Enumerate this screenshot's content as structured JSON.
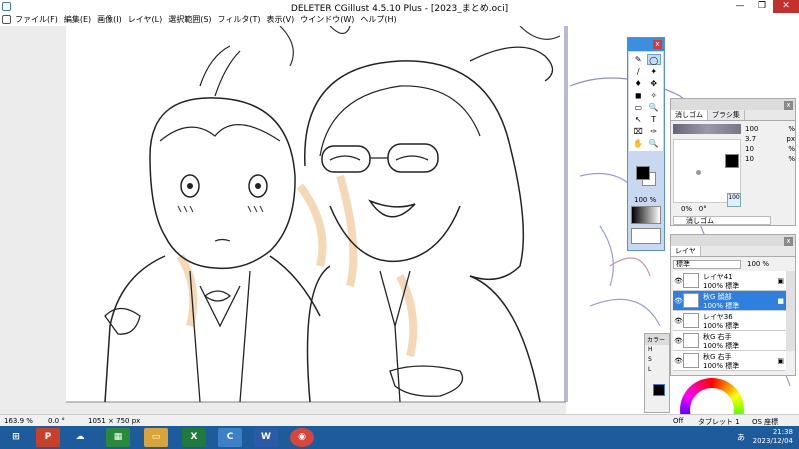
{
  "window": {
    "title": "DELETER CGillust 4.5.10 Plus - [2023_まとめ.oci]",
    "controls": [
      "—",
      "❐",
      "✕"
    ]
  },
  "menu": [
    "ファイル(F)",
    "編集(E)",
    "画像(I)",
    "レイヤ(L)",
    "選択範囲(S)",
    "フィルタ(T)",
    "表示(V)",
    "ウインドウ(W)",
    "ヘルプ(H)"
  ],
  "tool_palette": {
    "zoom": "100",
    "zoom_unit": "%",
    "tools": [
      "✎",
      "◯",
      "∕",
      "✦",
      "♦",
      "✥",
      "◼",
      "✧",
      "▭",
      "🔍",
      "↖",
      "T",
      "⌧",
      "✑",
      "✋",
      "🔍"
    ]
  },
  "brush_panel": {
    "tabs": [
      "消しゴム",
      "ブラシ集"
    ],
    "opacity": "100",
    "size": "3.7",
    "size_unit": "px",
    "density": "10",
    "spacing": "10",
    "angle_label": "0%",
    "angle_value": "0°",
    "hardness": "100",
    "brush_name": "消しゴム"
  },
  "layer_panel": {
    "tab": "レイヤ",
    "blend_mode": "標準",
    "opacity": "100",
    "opacity_unit": "%",
    "layers": [
      {
        "name": "レイヤ41",
        "mode": "100% 標準",
        "selected": false,
        "visible": true
      },
      {
        "name": "秋G 顔部",
        "mode": "100% 標準",
        "selected": true,
        "visible": true
      },
      {
        "name": "レイヤ36",
        "mode": "100% 標準",
        "selected": false,
        "visible": true
      },
      {
        "name": "秋G 右手",
        "mode": "100% 標準",
        "selected": false,
        "visible": true
      },
      {
        "name": "秋G 右手",
        "mode": "100% 標準",
        "selected": false,
        "visible": true
      }
    ]
  },
  "color_panel": {
    "tab": "カラー",
    "labels": [
      "H",
      "S",
      "L"
    ]
  },
  "statusbar": {
    "zoom": "163.9 %",
    "angle": "0.0 °",
    "size": "1051 × 750 px",
    "off": "Off",
    "tablet": "タブレット 1",
    "coord": "OS 座標"
  },
  "taskbar": {
    "apps": [
      {
        "label": "⊞",
        "color": "#1e5b9c"
      },
      {
        "label": "P",
        "color": "#c9402a"
      },
      {
        "label": "☁",
        "color": "#2e6fb6"
      },
      {
        "label": "▦",
        "color": "#2a8a3c"
      },
      {
        "label": "▭",
        "color": "#d9a53a"
      },
      {
        "label": "X",
        "color": "#1f7a3c"
      },
      {
        "label": "C",
        "color": "#3d80c8"
      },
      {
        "label": "W",
        "color": "#2b5aa8"
      },
      {
        "label": "◉",
        "color": "#d8453a"
      }
    ],
    "time": "21:38",
    "date": "2023/12/04",
    "ime": "あ"
  }
}
